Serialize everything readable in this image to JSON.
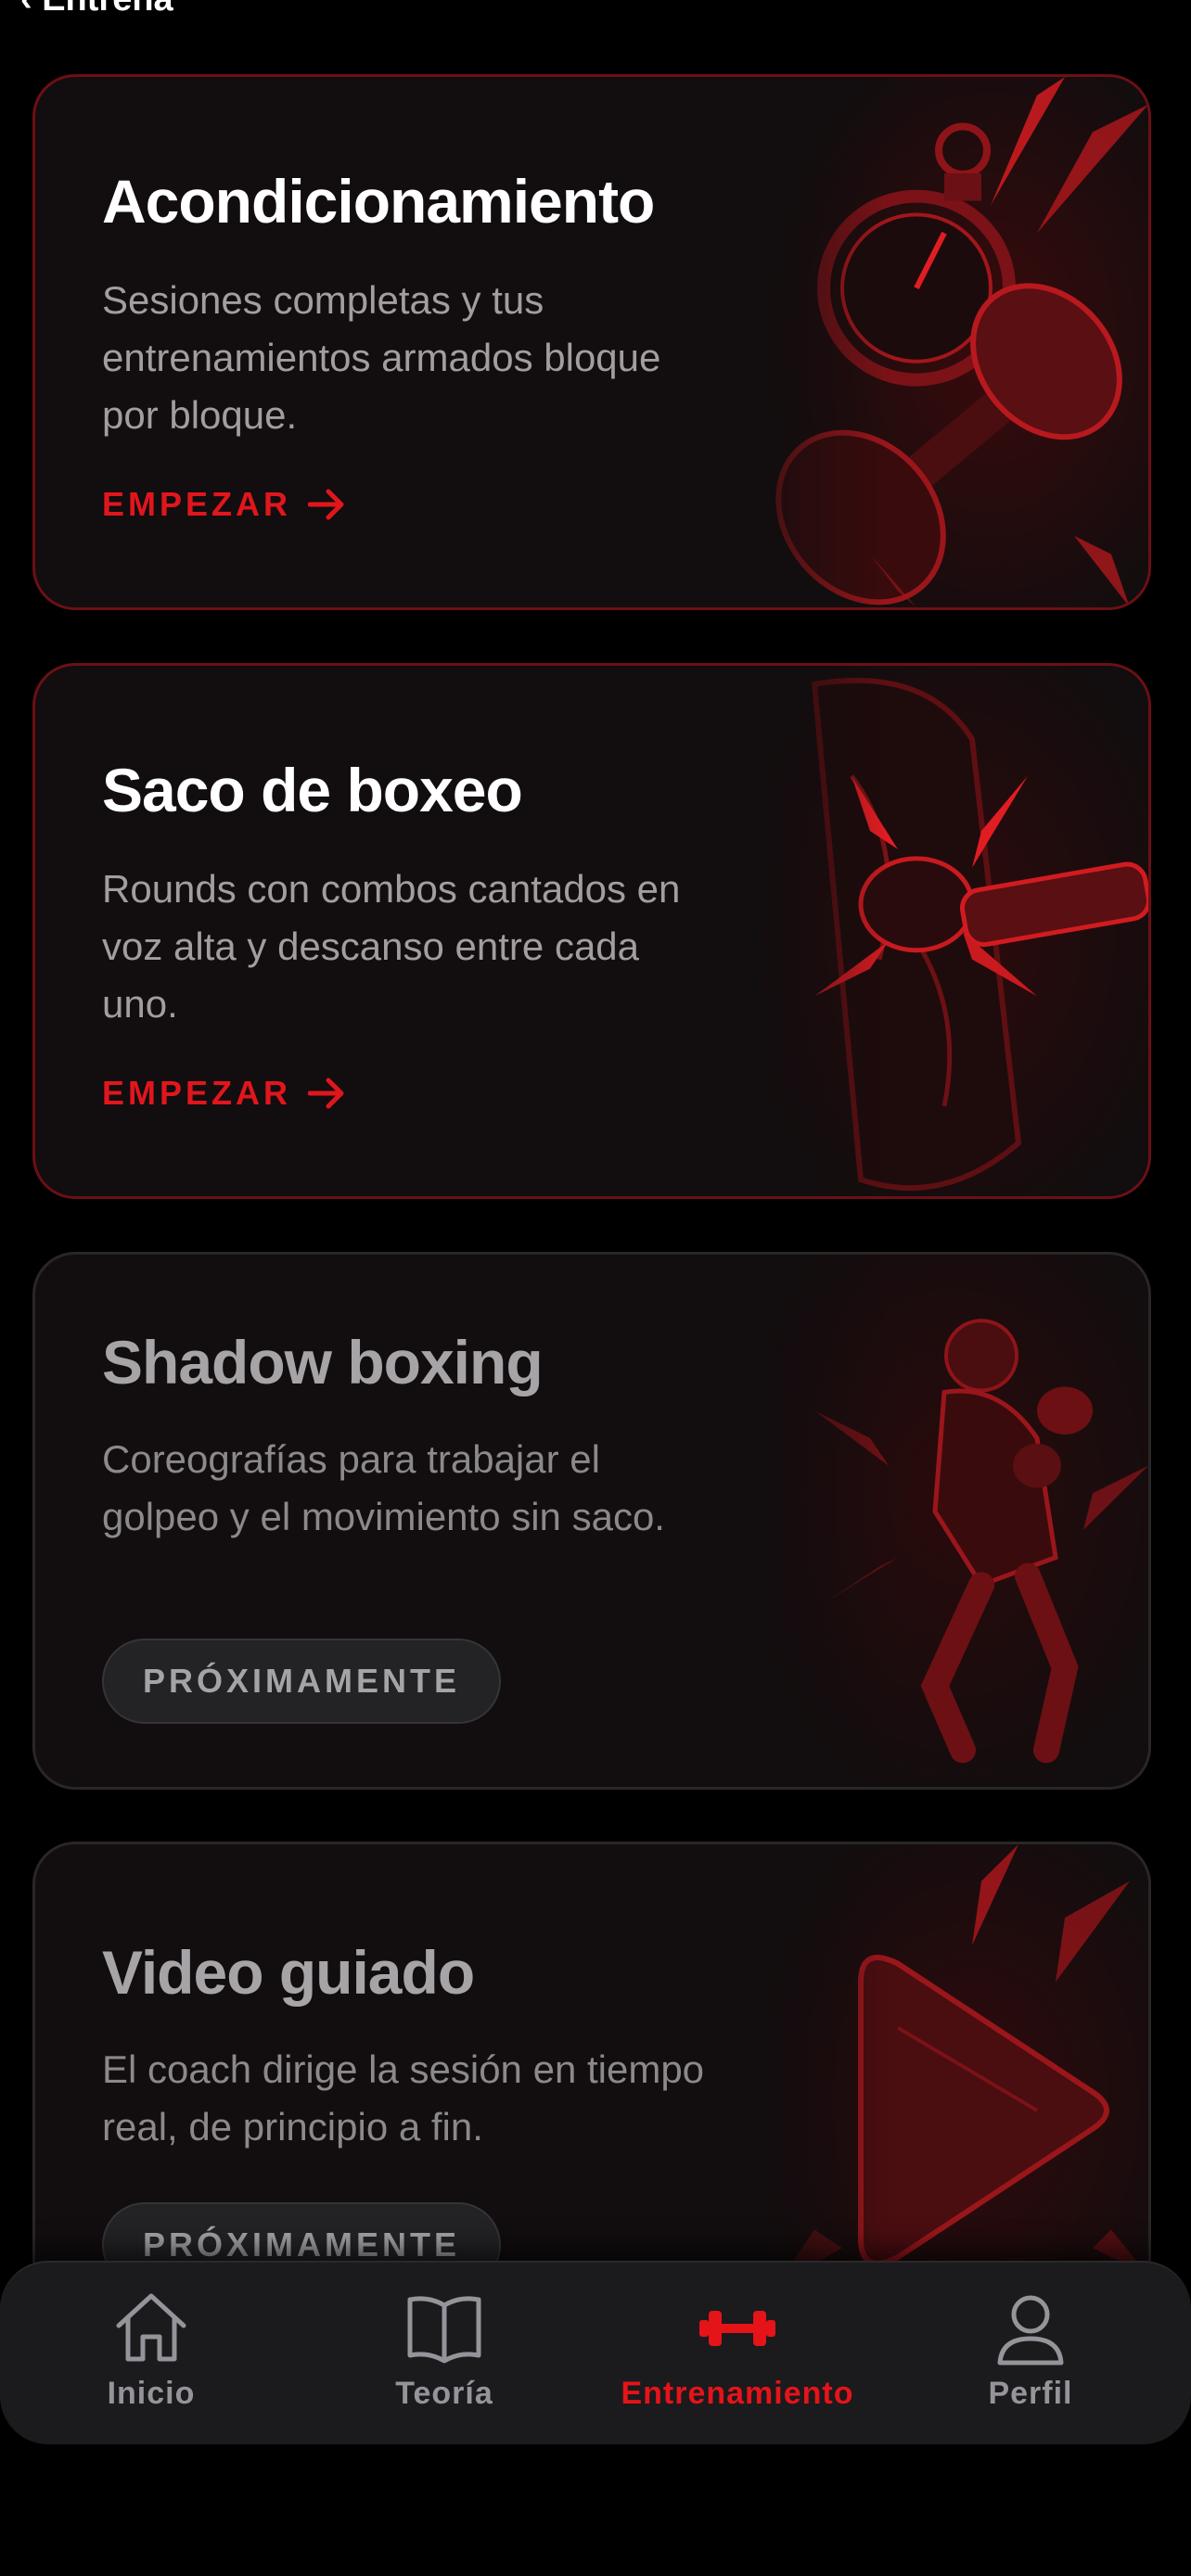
{
  "header": {
    "back_label": "‹ Entrena"
  },
  "cards": [
    {
      "title": "Acondicionamiento",
      "description": "Sesiones completas y tus entrenamientos armados bloque por bloque.",
      "action": "EMPEZAR",
      "status": "active",
      "art": "stopwatch-dumbbell-illustration"
    },
    {
      "title": "Saco de boxeo",
      "description": "Rounds con combos cantados en voz alta y descanso entre cada uno.",
      "action": "EMPEZAR",
      "status": "active",
      "art": "punching-bag-glove-illustration"
    },
    {
      "title": "Shadow boxing",
      "description": "Coreografías para trabajar el golpeo y el movimiento sin saco.",
      "action": "PRÓXIMAMENTE",
      "status": "coming-soon",
      "art": "boxer-silhouette-illustration"
    },
    {
      "title": "Video guiado",
      "description": "El coach dirige la sesión en tiempo real, de principio a fin.",
      "action": "PRÓXIMAMENTE",
      "status": "coming-soon",
      "art": "play-button-illustration"
    }
  ],
  "tabbar": {
    "items": [
      {
        "label": "Inicio",
        "icon": "home-icon"
      },
      {
        "label": "Teoría",
        "icon": "book-icon"
      },
      {
        "label": "Entrenamiento",
        "icon": "dumbbell-icon",
        "active": true
      },
      {
        "label": "Perfil",
        "icon": "person-icon"
      }
    ]
  },
  "colors": {
    "accent": "#e1161d",
    "background": "#000000",
    "card": "#120d0e"
  }
}
